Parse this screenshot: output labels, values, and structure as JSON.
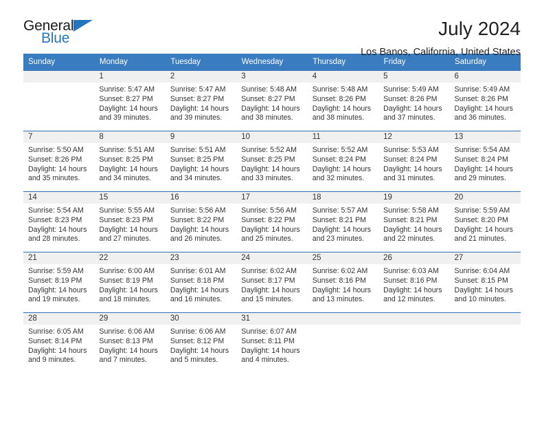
{
  "logo": {
    "primary_text": "General",
    "secondary_text": "Blue",
    "accent_color": "#2475bb",
    "triangle_icon": "triangle-icon"
  },
  "header": {
    "title": "July 2024",
    "subtitle": "Los Banos, California, United States"
  },
  "calendar": {
    "header_bg": "#3a7cc0",
    "daynum_bg": "#f0f0f0",
    "weekdays": [
      "Sunday",
      "Monday",
      "Tuesday",
      "Wednesday",
      "Thursday",
      "Friday",
      "Saturday"
    ],
    "labels": {
      "sunrise": "Sunrise:",
      "sunset": "Sunset:",
      "daylight": "Daylight:"
    },
    "weeks": [
      [
        {
          "day": "",
          "sunrise": "",
          "sunset": "",
          "daylight_line1": "",
          "daylight_line2": ""
        },
        {
          "day": "1",
          "sunrise": "Sunrise: 5:47 AM",
          "sunset": "Sunset: 8:27 PM",
          "daylight_line1": "Daylight: 14 hours",
          "daylight_line2": "and 39 minutes."
        },
        {
          "day": "2",
          "sunrise": "Sunrise: 5:47 AM",
          "sunset": "Sunset: 8:27 PM",
          "daylight_line1": "Daylight: 14 hours",
          "daylight_line2": "and 39 minutes."
        },
        {
          "day": "3",
          "sunrise": "Sunrise: 5:48 AM",
          "sunset": "Sunset: 8:27 PM",
          "daylight_line1": "Daylight: 14 hours",
          "daylight_line2": "and 38 minutes."
        },
        {
          "day": "4",
          "sunrise": "Sunrise: 5:48 AM",
          "sunset": "Sunset: 8:26 PM",
          "daylight_line1": "Daylight: 14 hours",
          "daylight_line2": "and 38 minutes."
        },
        {
          "day": "5",
          "sunrise": "Sunrise: 5:49 AM",
          "sunset": "Sunset: 8:26 PM",
          "daylight_line1": "Daylight: 14 hours",
          "daylight_line2": "and 37 minutes."
        },
        {
          "day": "6",
          "sunrise": "Sunrise: 5:49 AM",
          "sunset": "Sunset: 8:26 PM",
          "daylight_line1": "Daylight: 14 hours",
          "daylight_line2": "and 36 minutes."
        }
      ],
      [
        {
          "day": "7",
          "sunrise": "Sunrise: 5:50 AM",
          "sunset": "Sunset: 8:26 PM",
          "daylight_line1": "Daylight: 14 hours",
          "daylight_line2": "and 35 minutes."
        },
        {
          "day": "8",
          "sunrise": "Sunrise: 5:51 AM",
          "sunset": "Sunset: 8:25 PM",
          "daylight_line1": "Daylight: 14 hours",
          "daylight_line2": "and 34 minutes."
        },
        {
          "day": "9",
          "sunrise": "Sunrise: 5:51 AM",
          "sunset": "Sunset: 8:25 PM",
          "daylight_line1": "Daylight: 14 hours",
          "daylight_line2": "and 34 minutes."
        },
        {
          "day": "10",
          "sunrise": "Sunrise: 5:52 AM",
          "sunset": "Sunset: 8:25 PM",
          "daylight_line1": "Daylight: 14 hours",
          "daylight_line2": "and 33 minutes."
        },
        {
          "day": "11",
          "sunrise": "Sunrise: 5:52 AM",
          "sunset": "Sunset: 8:24 PM",
          "daylight_line1": "Daylight: 14 hours",
          "daylight_line2": "and 32 minutes."
        },
        {
          "day": "12",
          "sunrise": "Sunrise: 5:53 AM",
          "sunset": "Sunset: 8:24 PM",
          "daylight_line1": "Daylight: 14 hours",
          "daylight_line2": "and 31 minutes."
        },
        {
          "day": "13",
          "sunrise": "Sunrise: 5:54 AM",
          "sunset": "Sunset: 8:24 PM",
          "daylight_line1": "Daylight: 14 hours",
          "daylight_line2": "and 29 minutes."
        }
      ],
      [
        {
          "day": "14",
          "sunrise": "Sunrise: 5:54 AM",
          "sunset": "Sunset: 8:23 PM",
          "daylight_line1": "Daylight: 14 hours",
          "daylight_line2": "and 28 minutes."
        },
        {
          "day": "15",
          "sunrise": "Sunrise: 5:55 AM",
          "sunset": "Sunset: 8:23 PM",
          "daylight_line1": "Daylight: 14 hours",
          "daylight_line2": "and 27 minutes."
        },
        {
          "day": "16",
          "sunrise": "Sunrise: 5:56 AM",
          "sunset": "Sunset: 8:22 PM",
          "daylight_line1": "Daylight: 14 hours",
          "daylight_line2": "and 26 minutes."
        },
        {
          "day": "17",
          "sunrise": "Sunrise: 5:56 AM",
          "sunset": "Sunset: 8:22 PM",
          "daylight_line1": "Daylight: 14 hours",
          "daylight_line2": "and 25 minutes."
        },
        {
          "day": "18",
          "sunrise": "Sunrise: 5:57 AM",
          "sunset": "Sunset: 8:21 PM",
          "daylight_line1": "Daylight: 14 hours",
          "daylight_line2": "and 23 minutes."
        },
        {
          "day": "19",
          "sunrise": "Sunrise: 5:58 AM",
          "sunset": "Sunset: 8:21 PM",
          "daylight_line1": "Daylight: 14 hours",
          "daylight_line2": "and 22 minutes."
        },
        {
          "day": "20",
          "sunrise": "Sunrise: 5:59 AM",
          "sunset": "Sunset: 8:20 PM",
          "daylight_line1": "Daylight: 14 hours",
          "daylight_line2": "and 21 minutes."
        }
      ],
      [
        {
          "day": "21",
          "sunrise": "Sunrise: 5:59 AM",
          "sunset": "Sunset: 8:19 PM",
          "daylight_line1": "Daylight: 14 hours",
          "daylight_line2": "and 19 minutes."
        },
        {
          "day": "22",
          "sunrise": "Sunrise: 6:00 AM",
          "sunset": "Sunset: 8:19 PM",
          "daylight_line1": "Daylight: 14 hours",
          "daylight_line2": "and 18 minutes."
        },
        {
          "day": "23",
          "sunrise": "Sunrise: 6:01 AM",
          "sunset": "Sunset: 8:18 PM",
          "daylight_line1": "Daylight: 14 hours",
          "daylight_line2": "and 16 minutes."
        },
        {
          "day": "24",
          "sunrise": "Sunrise: 6:02 AM",
          "sunset": "Sunset: 8:17 PM",
          "daylight_line1": "Daylight: 14 hours",
          "daylight_line2": "and 15 minutes."
        },
        {
          "day": "25",
          "sunrise": "Sunrise: 6:02 AM",
          "sunset": "Sunset: 8:16 PM",
          "daylight_line1": "Daylight: 14 hours",
          "daylight_line2": "and 13 minutes."
        },
        {
          "day": "26",
          "sunrise": "Sunrise: 6:03 AM",
          "sunset": "Sunset: 8:16 PM",
          "daylight_line1": "Daylight: 14 hours",
          "daylight_line2": "and 12 minutes."
        },
        {
          "day": "27",
          "sunrise": "Sunrise: 6:04 AM",
          "sunset": "Sunset: 8:15 PM",
          "daylight_line1": "Daylight: 14 hours",
          "daylight_line2": "and 10 minutes."
        }
      ],
      [
        {
          "day": "28",
          "sunrise": "Sunrise: 6:05 AM",
          "sunset": "Sunset: 8:14 PM",
          "daylight_line1": "Daylight: 14 hours",
          "daylight_line2": "and 9 minutes."
        },
        {
          "day": "29",
          "sunrise": "Sunrise: 6:06 AM",
          "sunset": "Sunset: 8:13 PM",
          "daylight_line1": "Daylight: 14 hours",
          "daylight_line2": "and 7 minutes."
        },
        {
          "day": "30",
          "sunrise": "Sunrise: 6:06 AM",
          "sunset": "Sunset: 8:12 PM",
          "daylight_line1": "Daylight: 14 hours",
          "daylight_line2": "and 5 minutes."
        },
        {
          "day": "31",
          "sunrise": "Sunrise: 6:07 AM",
          "sunset": "Sunset: 8:11 PM",
          "daylight_line1": "Daylight: 14 hours",
          "daylight_line2": "and 4 minutes."
        },
        {
          "day": "",
          "sunrise": "",
          "sunset": "",
          "daylight_line1": "",
          "daylight_line2": ""
        },
        {
          "day": "",
          "sunrise": "",
          "sunset": "",
          "daylight_line1": "",
          "daylight_line2": ""
        },
        {
          "day": "",
          "sunrise": "",
          "sunset": "",
          "daylight_line1": "",
          "daylight_line2": ""
        }
      ]
    ]
  }
}
